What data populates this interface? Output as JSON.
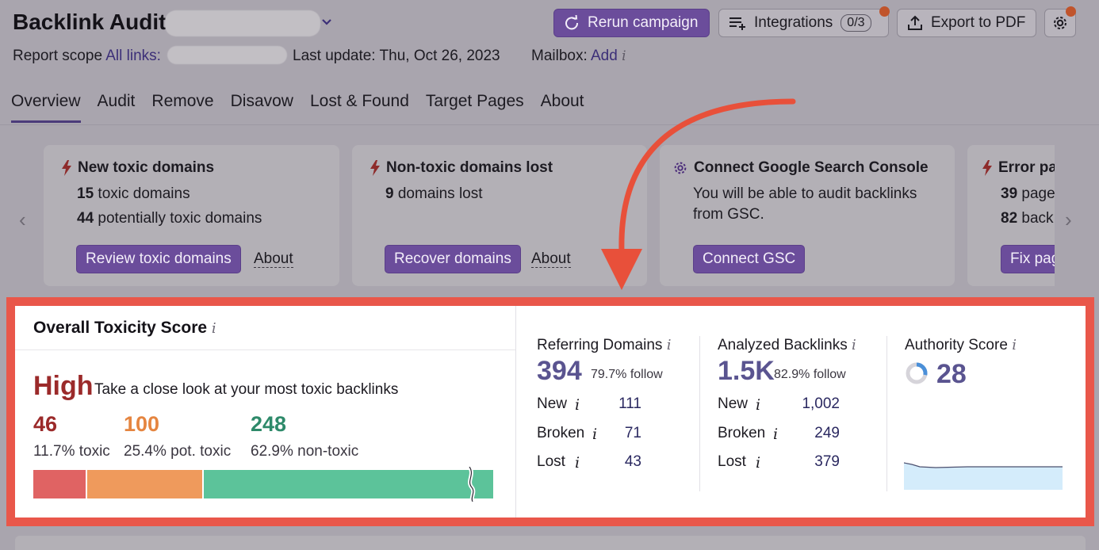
{
  "header": {
    "title": "Backlink Audit:",
    "report_scope_label": "Report scope",
    "all_links_label": "All links:",
    "last_update": "Last update: Thu, Oct 26, 2023",
    "mailbox_label": "Mailbox:",
    "mailbox_link": "Add",
    "info_glyph": "i",
    "buttons": {
      "rerun": "Rerun campaign",
      "integrations": "Integrations",
      "integrations_count": "0/3",
      "export": "Export to PDF"
    },
    "icons": {
      "rerun": "refresh-icon",
      "integrations": "playlist-add-icon",
      "export": "upload-icon",
      "settings": "gear-icon"
    }
  },
  "tabs": [
    "Overview",
    "Audit",
    "Remove",
    "Disavow",
    "Lost & Found",
    "Target Pages",
    "About"
  ],
  "active_tab": "Overview",
  "cards": [
    {
      "title": "New toxic domains",
      "icon": "lightning-icon",
      "lines": [
        {
          "num": "15",
          "text": " toxic domains"
        },
        {
          "num": "44",
          "text": " potentially toxic domains"
        }
      ],
      "button": "Review toxic domains",
      "about": "About"
    },
    {
      "title": "Non-toxic domains lost",
      "icon": "lightning-icon",
      "lines": [
        {
          "num": "9",
          "text": " domains lost"
        }
      ],
      "button": "Recover domains",
      "about": "About"
    },
    {
      "title": "Connect Google Search Console",
      "icon": "gear-icon",
      "lines": [
        {
          "num": "",
          "text": "You will be able to audit backlinks"
        },
        {
          "num": "",
          "text": "from GSC."
        }
      ],
      "button": "Connect GSC",
      "about": ""
    },
    {
      "title": "Error pa",
      "icon": "lightning-icon",
      "lines": [
        {
          "num": "39",
          "text": " page"
        },
        {
          "num": "82",
          "text": " back"
        }
      ],
      "button": "Fix pag",
      "about": ""
    }
  ],
  "toxicity": {
    "title": "Overall Toxicity Score",
    "level": "High",
    "level_sub": "Take a close look at your most toxic backlinks",
    "toxic": {
      "count": "46",
      "label": "11.7% toxic",
      "share": 0.117,
      "color": "#e06363"
    },
    "pot_toxic": {
      "count": "100",
      "label": "25.4% pot. toxic",
      "share": 0.254,
      "color": "#ef9a5c"
    },
    "non_toxic": {
      "count": "248",
      "label": "62.9% non-toxic",
      "share": 0.629,
      "color": "#5cc39a"
    }
  },
  "referring_domains": {
    "label": "Referring Domains",
    "value": "394",
    "follow": "79.7% follow",
    "rows": [
      {
        "label": "New",
        "value": "111"
      },
      {
        "label": "Broken",
        "value": "71"
      },
      {
        "label": "Lost",
        "value": "43"
      }
    ]
  },
  "analyzed_backlinks": {
    "label": "Analyzed Backlinks",
    "value": "1.5K",
    "follow": "82.9% follow",
    "rows": [
      {
        "label": "New",
        "value": "1,002"
      },
      {
        "label": "Broken",
        "value": "249"
      },
      {
        "label": "Lost",
        "value": "379"
      }
    ]
  },
  "authority": {
    "label": "Authority Score",
    "value": "28",
    "ring_share": 0.28
  },
  "colors": {
    "accent_purple": "#6b4d9b",
    "highlight_red": "#e9574a",
    "annotation_arrow": "#e8503a",
    "metric_purple": "#5a5490"
  }
}
